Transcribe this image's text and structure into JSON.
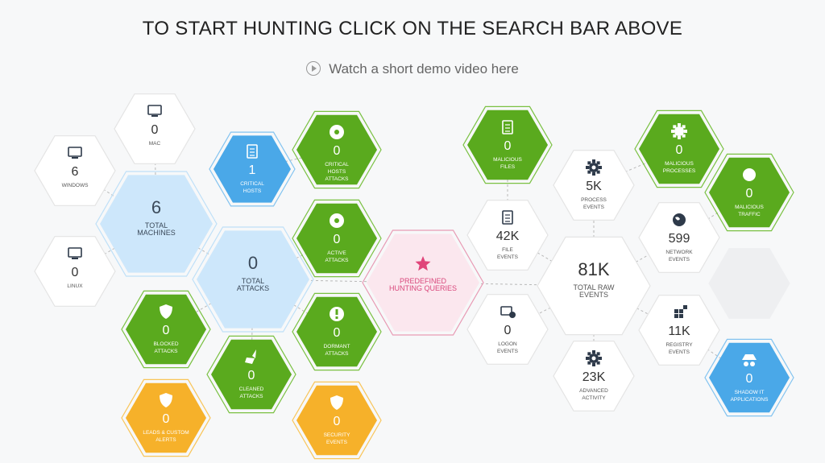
{
  "header": {
    "title": "TO START HUNTING CLICK ON THE SEARCH BAR ABOVE",
    "demo_link": "Watch a short demo video here"
  },
  "colors": {
    "green": "#5aaa1e",
    "green_border": "#7ac142",
    "blue": "#4aa8e8",
    "light_blue": "#cde7fb",
    "orange": "#f6b12a",
    "pink": "#fbe7ee",
    "pink_border": "#e89ab4",
    "pink_text": "#d9487c",
    "white": "#ffffff"
  },
  "nodes": {
    "mac": {
      "value": "0",
      "label": "MAC",
      "icon": "mac-icon"
    },
    "windows": {
      "value": "6",
      "label": "WINDOWS",
      "icon": "windows-icon"
    },
    "linux": {
      "value": "0",
      "label": "LINUX",
      "icon": "linux-icon"
    },
    "total_machines": {
      "value": "6",
      "label": "TOTAL\nMACHINES"
    },
    "critical_hosts": {
      "value": "1",
      "label": "CRITICAL\nHOSTS",
      "icon": "critical-host-icon"
    },
    "critical_hosts_attacks": {
      "value": "0",
      "label": "CRITICAL\nHOSTS\nATTACKS",
      "icon": "biohazard-icon"
    },
    "active_attacks": {
      "value": "0",
      "label": "ACTIVE\nATTACKS",
      "icon": "biohazard-icon"
    },
    "total_attacks": {
      "value": "0",
      "label": "TOTAL\nATTACKS"
    },
    "blocked_attacks": {
      "value": "0",
      "label": "BLOCKED\nATTACKS",
      "icon": "shield-icon"
    },
    "dormant_attacks": {
      "value": "0",
      "label": "DORMANT\nATTACKS",
      "icon": "alert-icon"
    },
    "cleaned_attacks": {
      "value": "0",
      "label": "CLEANED\nATTACKS",
      "icon": "broom-icon"
    },
    "leads_custom_alerts": {
      "value": "0",
      "label": "LEADS & CUSTOM\nALERTS",
      "icon": "shield-icon"
    },
    "security_events": {
      "value": "0",
      "label": "SECURITY\nEVENTS",
      "icon": "shield-icon"
    },
    "predefined_queries": {
      "label": "PREDEFINED\nHUNTING QUERIES",
      "icon": "star-icon"
    },
    "malicious_files": {
      "value": "0",
      "label": "MALICIOUS\nFILES",
      "icon": "file-icon"
    },
    "process_events": {
      "value": "5K",
      "label": "PROCESS\nEVENTS",
      "icon": "gear-icon"
    },
    "malicious_processes": {
      "value": "0",
      "label": "MALICIOUS\nPROCESSES",
      "icon": "gear-icon"
    },
    "malicious_traffic": {
      "value": "0",
      "label": "MALICIOUS\nTRAFFIC",
      "icon": "globe-icon"
    },
    "file_events": {
      "value": "42K",
      "label": "FILE\nEVENTS",
      "icon": "file-icon"
    },
    "network_events": {
      "value": "599",
      "label": "NETWORK\nEVENTS",
      "icon": "globe-icon"
    },
    "total_raw_events": {
      "value": "81K",
      "label": "TOTAL RAW\nEVENTS"
    },
    "logon_events": {
      "value": "0",
      "label": "LOGON\nEVENTS",
      "icon": "logon-icon"
    },
    "registry_events": {
      "value": "11K",
      "label": "REGISTRY\nEVENTS",
      "icon": "registry-icon"
    },
    "advanced_activity": {
      "value": "23K",
      "label": "ADVANCED\nACTIVITY",
      "icon": "gears-icon"
    },
    "shadow_it": {
      "value": "0",
      "label": "SHADOW IT\nAPPLICATIONS",
      "icon": "spy-icon"
    },
    "placeholder": {}
  }
}
